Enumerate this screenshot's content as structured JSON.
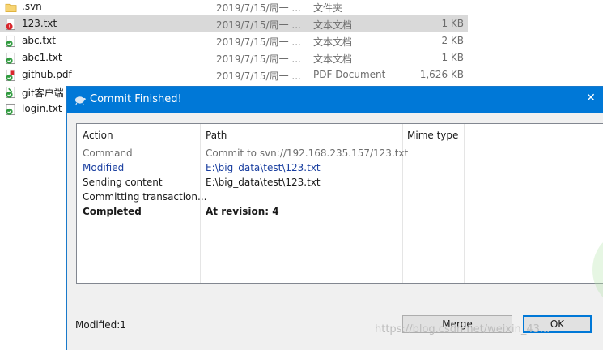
{
  "files": [
    {
      "name": ".svn",
      "date": "2019/7/15/周一 ...",
      "type": "文件夹",
      "size": "",
      "icon": "folder-icon",
      "selected": false
    },
    {
      "name": "123.txt",
      "date": "2019/7/15/周一 ...",
      "type": "文本文档",
      "size": "1 KB",
      "icon": "svn-conflict-text-file-icon",
      "selected": true
    },
    {
      "name": "abc.txt",
      "date": "2019/7/15/周一 ...",
      "type": "文本文档",
      "size": "2 KB",
      "icon": "svn-normal-text-file-icon",
      "selected": false
    },
    {
      "name": "abc1.txt",
      "date": "2019/7/15/周一 ...",
      "type": "文本文档",
      "size": "1 KB",
      "icon": "svn-normal-text-file-icon",
      "selected": false
    },
    {
      "name": "github.pdf",
      "date": "2019/7/15/周一 ...",
      "type": "PDF Document",
      "size": "1,626 KB",
      "icon": "svn-normal-pdf-file-icon",
      "selected": false
    },
    {
      "name": "git客户端",
      "date": "",
      "type": "",
      "size": "",
      "icon": "svn-normal-shortcut-icon",
      "selected": false
    },
    {
      "name": "login.txt",
      "date": "",
      "type": "",
      "size": "",
      "icon": "svn-normal-text-file-icon",
      "selected": false
    }
  ],
  "dialog": {
    "title": "Commit Finished!",
    "close_glyph": "✕",
    "columns": {
      "action": "Action",
      "path": "Path",
      "mime": "Mime type"
    },
    "rows": [
      {
        "action": "Command",
        "path": "Commit to svn://192.168.235.157/123.txt",
        "style": "command"
      },
      {
        "action": "Modified",
        "path": "E:\\big_data\\test\\123.txt",
        "style": "modified"
      },
      {
        "action": "Sending content",
        "path": "E:\\big_data\\test\\123.txt",
        "style": "normal"
      },
      {
        "action": "Committing transaction...",
        "path": "",
        "style": "normal"
      },
      {
        "action": "Completed",
        "path": "At revision: 4",
        "style": "bold"
      }
    ],
    "status": "Modified:1",
    "merge_label": "Merge",
    "ok_label": "OK"
  },
  "watermark": "https://blog.csdn.net/weixin_43..."
}
